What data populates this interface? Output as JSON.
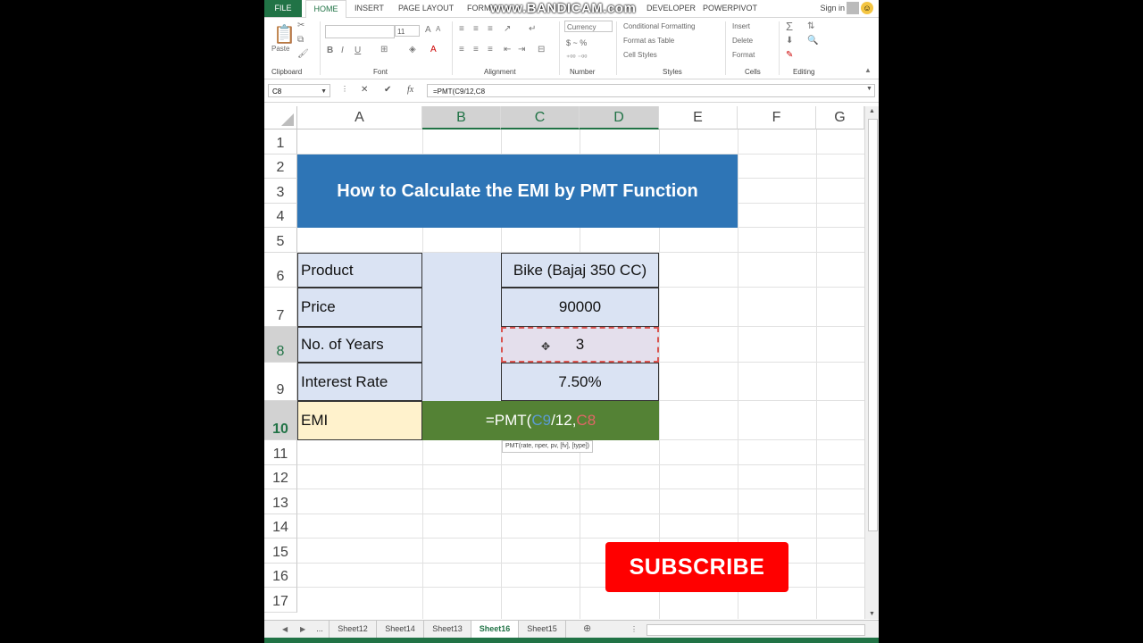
{
  "watermark": "www.BANDICAM.com",
  "ribbon_tabs": [
    "FILE",
    "HOME",
    "INSERT",
    "PAGE LAYOUT",
    "FORMU",
    "DEVELOPER",
    "POWERPIVOT"
  ],
  "sign_in": "Sign in",
  "ribbon": {
    "paste": "Paste",
    "clipboard": "Clipboard",
    "font_size": "11",
    "font": "Font",
    "alignment": "Alignment",
    "number_format": "Currency",
    "currency_symbol": "$ ~ %",
    "number": "Number",
    "conditional_formatting": "Conditional Formatting",
    "format_as_table": "Format as Table",
    "cell_styles": "Cell Styles",
    "styles": "Styles",
    "insert": "Insert",
    "delete": "Delete",
    "format": "Format",
    "cells": "Cells",
    "editing": "Editing"
  },
  "formula_bar": {
    "name_box": "C8",
    "formula": "=PMT(C9/12,C8"
  },
  "columns": [
    "A",
    "B",
    "C",
    "D",
    "E",
    "F",
    "G"
  ],
  "rows": [
    "1",
    "2",
    "3",
    "4",
    "5",
    "6",
    "7",
    "8",
    "9",
    "10",
    "11",
    "12",
    "13",
    "14",
    "15",
    "16",
    "17"
  ],
  "sheet": {
    "title": "How to Calculate the EMI by PMT Function",
    "labels": [
      "Product",
      "Price",
      "No. of Years",
      "Interest Rate"
    ],
    "values": [
      "Bike (Bajaj 350 CC)",
      "90000",
      "3",
      "7.50%"
    ],
    "emi_label": "EMI",
    "emi_formula": {
      "prefix": "=PMT(",
      "ref1": "C9",
      "mid": "/12,",
      "ref2": "C8"
    },
    "tooltip": "PMT(rate, nper, pv, [fv], [type])"
  },
  "subscribe": "SUBSCRIBE",
  "sheet_tabs": [
    "...",
    "Sheet12",
    "Sheet14",
    "Sheet13",
    "Sheet16",
    "Sheet15"
  ],
  "active_sheet": "Sheet16"
}
